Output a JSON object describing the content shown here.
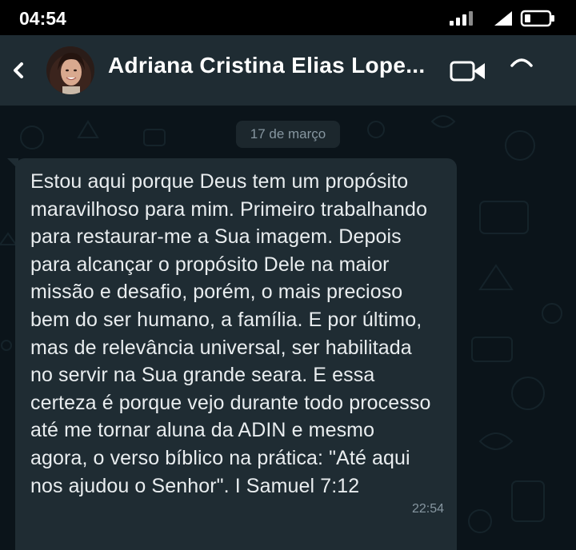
{
  "status_bar": {
    "time": "04:54"
  },
  "header": {
    "contact_name": "Adriana Cristina Elias Lope..."
  },
  "chat": {
    "date_label": "17 de março",
    "message": {
      "lines": [
        "Estou aqui porque Deus tem um propósito",
        "maravilhoso para mim. Primeiro trabalhando",
        "para restaurar-me a Sua imagem. Depois",
        "para alcançar o propósito Dele na maior",
        "missão e desafio, porém, o mais precioso",
        "bem do ser humano, a família. E por último,",
        "mas de relevância universal, ser habilitada",
        "no servir na Sua grande seara. E essa",
        "certeza é porque vejo durante todo processo",
        "até me tornar aluna da ADIN e mesmo",
        "agora, o verso bíblico na prática: \"Até aqui",
        "nos ajudou o Senhor\". I Samuel 7:12"
      ],
      "time": "22:54"
    }
  },
  "colors": {
    "header_bg": "#1f2c33",
    "chat_bg": "#0b141a",
    "bubble_bg": "#1f2c33",
    "text": "#e9edef",
    "meta_text": "#8696a0"
  },
  "icons": {
    "back": "chevron-left-icon",
    "video": "video-camera-icon",
    "call": "phone-icon",
    "signal": "signal-bars-icon",
    "wifi": "wifi-icon",
    "battery": "battery-icon"
  }
}
